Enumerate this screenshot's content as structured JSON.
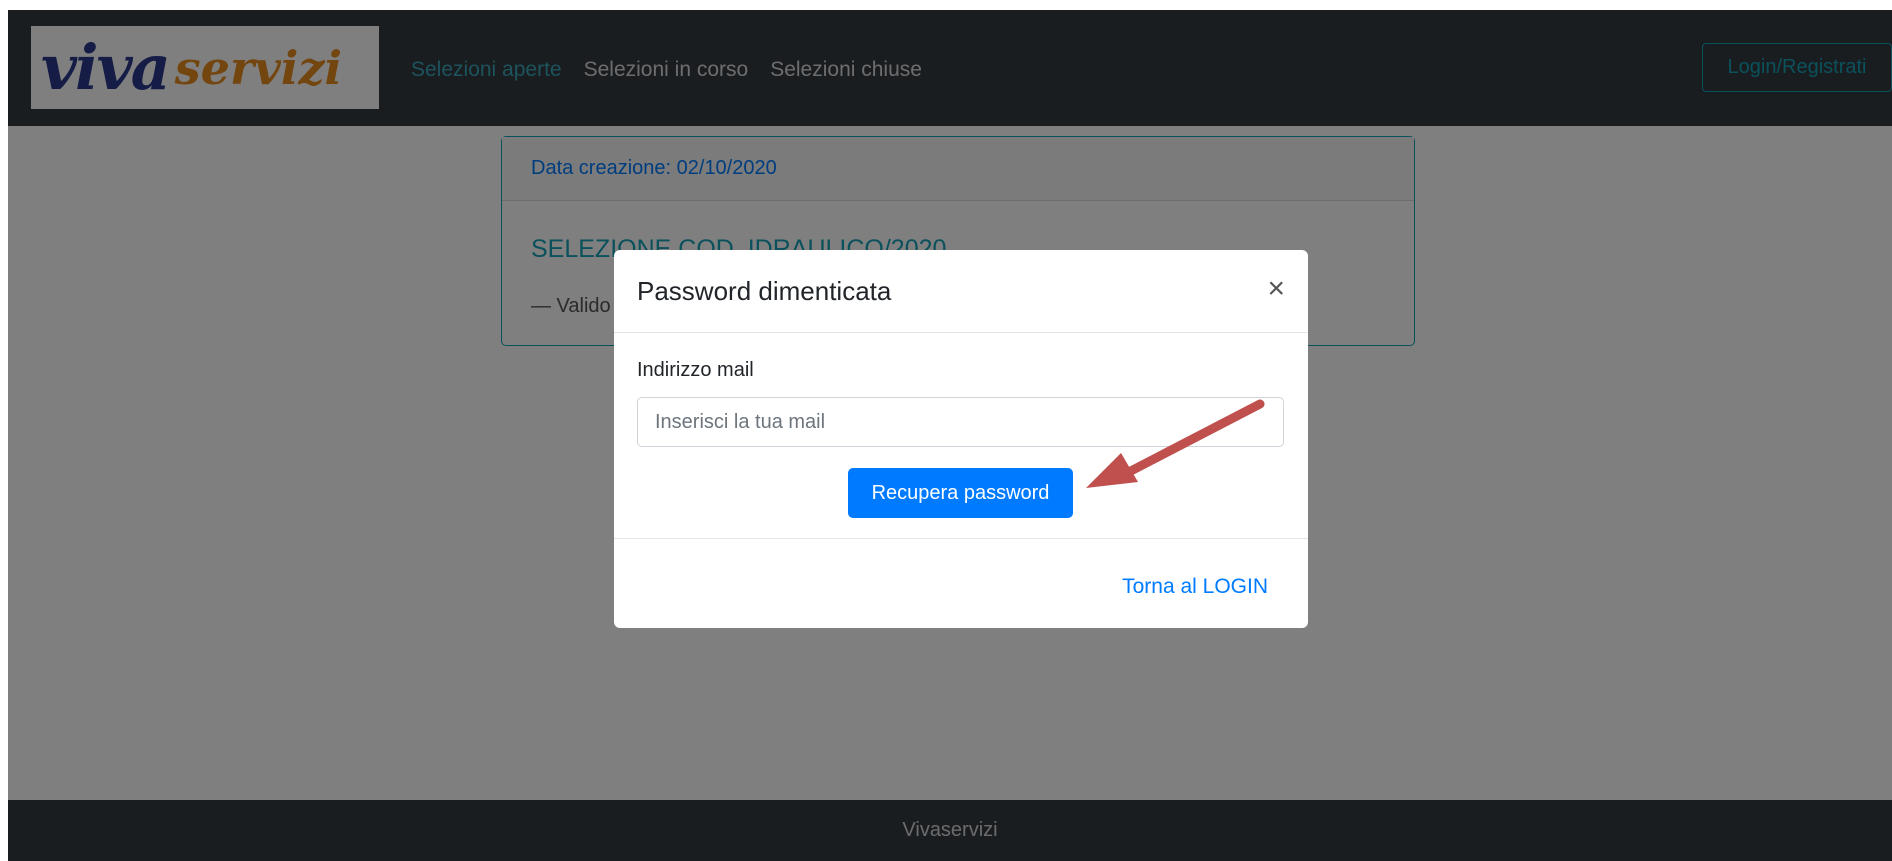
{
  "navbar": {
    "brand": {
      "part1": "viva",
      "part2": "servizi"
    },
    "links": [
      {
        "label": "Selezioni aperte",
        "active": true
      },
      {
        "label": "Selezioni in corso",
        "active": false
      },
      {
        "label": "Selezioni chiuse",
        "active": false
      }
    ],
    "login_label": "Login/Registrati"
  },
  "card": {
    "header": "Data creazione: 02/10/2020",
    "title": "SELEZIONE COD. IDRAULICO/2020",
    "text": "— Valido"
  },
  "modal": {
    "title": "Password dimenticata",
    "close_symbol": "×",
    "email_label": "Indirizzo mail",
    "email_placeholder": "Inserisci la tua mail",
    "email_value": "",
    "submit_label": "Recupera password",
    "back_link": "Torna al LOGIN"
  },
  "annotation": {
    "arrow_color": "#c0504d"
  },
  "footer": {
    "text": "Vivaservizi"
  },
  "colors": {
    "navbar_bg": "#343a40",
    "accent_info": "#17a2b8",
    "primary": "#007bff"
  }
}
